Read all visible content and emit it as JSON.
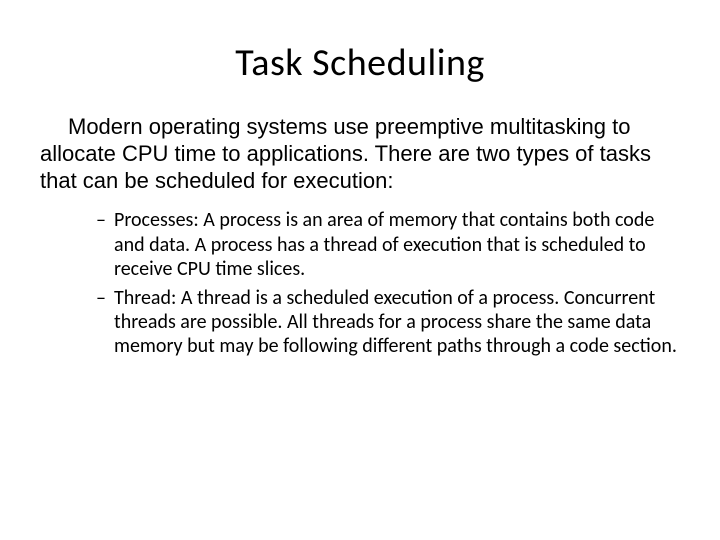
{
  "slide": {
    "title": "Task Scheduling",
    "intro": "Modern operating systems use preemptive multitasking to allocate CPU time to applications. There are two types of tasks that can be scheduled for execution:",
    "bullets": [
      "Processes: A process is an area of memory that contains both code and data. A process has a thread of execution that is scheduled to receive CPU time slices.",
      "Thread: A thread is a scheduled execution of a process. Concurrent threads are possible. All threads for a process share the same data memory but may be following different paths through a code section."
    ]
  }
}
